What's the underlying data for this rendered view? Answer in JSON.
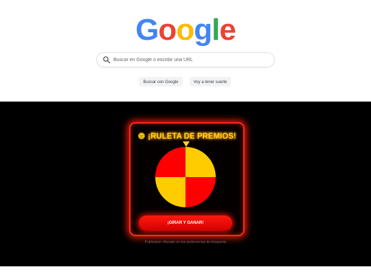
{
  "google": {
    "logo": [
      {
        "char": "G",
        "color": "#4285F4"
      },
      {
        "char": "o",
        "color": "#EA4335"
      },
      {
        "char": "o",
        "color": "#FBBC05"
      },
      {
        "char": "g",
        "color": "#4285F4"
      },
      {
        "char": "l",
        "color": "#34A853"
      },
      {
        "char": "e",
        "color": "#EA4335"
      }
    ],
    "search": {
      "placeholder": "Buscar en Google o escribir una URL",
      "value": "",
      "icon": "search-icon"
    },
    "buttons": {
      "search_label": "Buscar con Google",
      "lucky_label": "Voy a tener suerte"
    }
  },
  "ad": {
    "title": "¡RULETA DE PREMIOS!",
    "title_icon": "prize-emoji-icon",
    "wheel": {
      "segments": [
        {
          "color": "#ffcc00"
        },
        {
          "color": "#ff0000"
        },
        {
          "color": "#ffcc00"
        },
        {
          "color": "#ff0000"
        }
      ]
    },
    "cta_label": "¡GIRAR Y GANAR!",
    "footnote": "Publicidad • Basado en tus preferencias de búsqueda",
    "colors": {
      "background": "#000000",
      "glow": "#ff2a1a",
      "title": "#ffd21f"
    }
  }
}
